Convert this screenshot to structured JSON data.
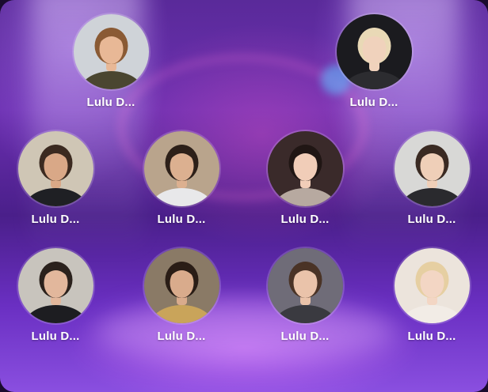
{
  "users": [
    {
      "name": "Lulu D...",
      "avatar": {
        "bg": "#cfd3d8",
        "skin": "#e8b896",
        "hair": "#8a5a34",
        "shirt": "#4a4630"
      }
    },
    {
      "name": "Lulu D...",
      "avatar": {
        "bg": "#1b1b1f",
        "skin": "#f0d2bc",
        "hair": "#e9d9b6",
        "shirt": "#2c2c30"
      }
    },
    {
      "name": "Lulu D...",
      "avatar": {
        "bg": "#cfc6b5",
        "skin": "#d9a887",
        "hair": "#3b2a20",
        "shirt": "#1f2024"
      }
    },
    {
      "name": "Lulu D...",
      "avatar": {
        "bg": "#b9a48c",
        "skin": "#dcb090",
        "hair": "#2d2019",
        "shirt": "#e8e8ea"
      }
    },
    {
      "name": "Lulu D...",
      "avatar": {
        "bg": "#3a2a2a",
        "skin": "#f1cdb8",
        "hair": "#201614",
        "shirt": "#b7a9a0"
      }
    },
    {
      "name": "Lulu D...",
      "avatar": {
        "bg": "#d8d8d6",
        "skin": "#efcfb8",
        "hair": "#3a2a22",
        "shirt": "#2a2a2e"
      }
    },
    {
      "name": "Lulu D...",
      "avatar": {
        "bg": "#c8c4bd",
        "skin": "#e2b79c",
        "hair": "#2a211c",
        "shirt": "#1d1d21"
      }
    },
    {
      "name": "Lulu D...",
      "avatar": {
        "bg": "#8a7a66",
        "skin": "#d9ab8c",
        "hair": "#2a1d16",
        "shirt": "#c9a45a"
      }
    },
    {
      "name": "Lulu D...",
      "avatar": {
        "bg": "#6f6c78",
        "skin": "#eac3aa",
        "hair": "#4a3326",
        "shirt": "#3a3a40"
      }
    },
    {
      "name": "Lulu D...",
      "avatar": {
        "bg": "#ece4dc",
        "skin": "#f3d6c4",
        "hair": "#e6cfa2",
        "shirt": "#f2ece6"
      }
    }
  ]
}
